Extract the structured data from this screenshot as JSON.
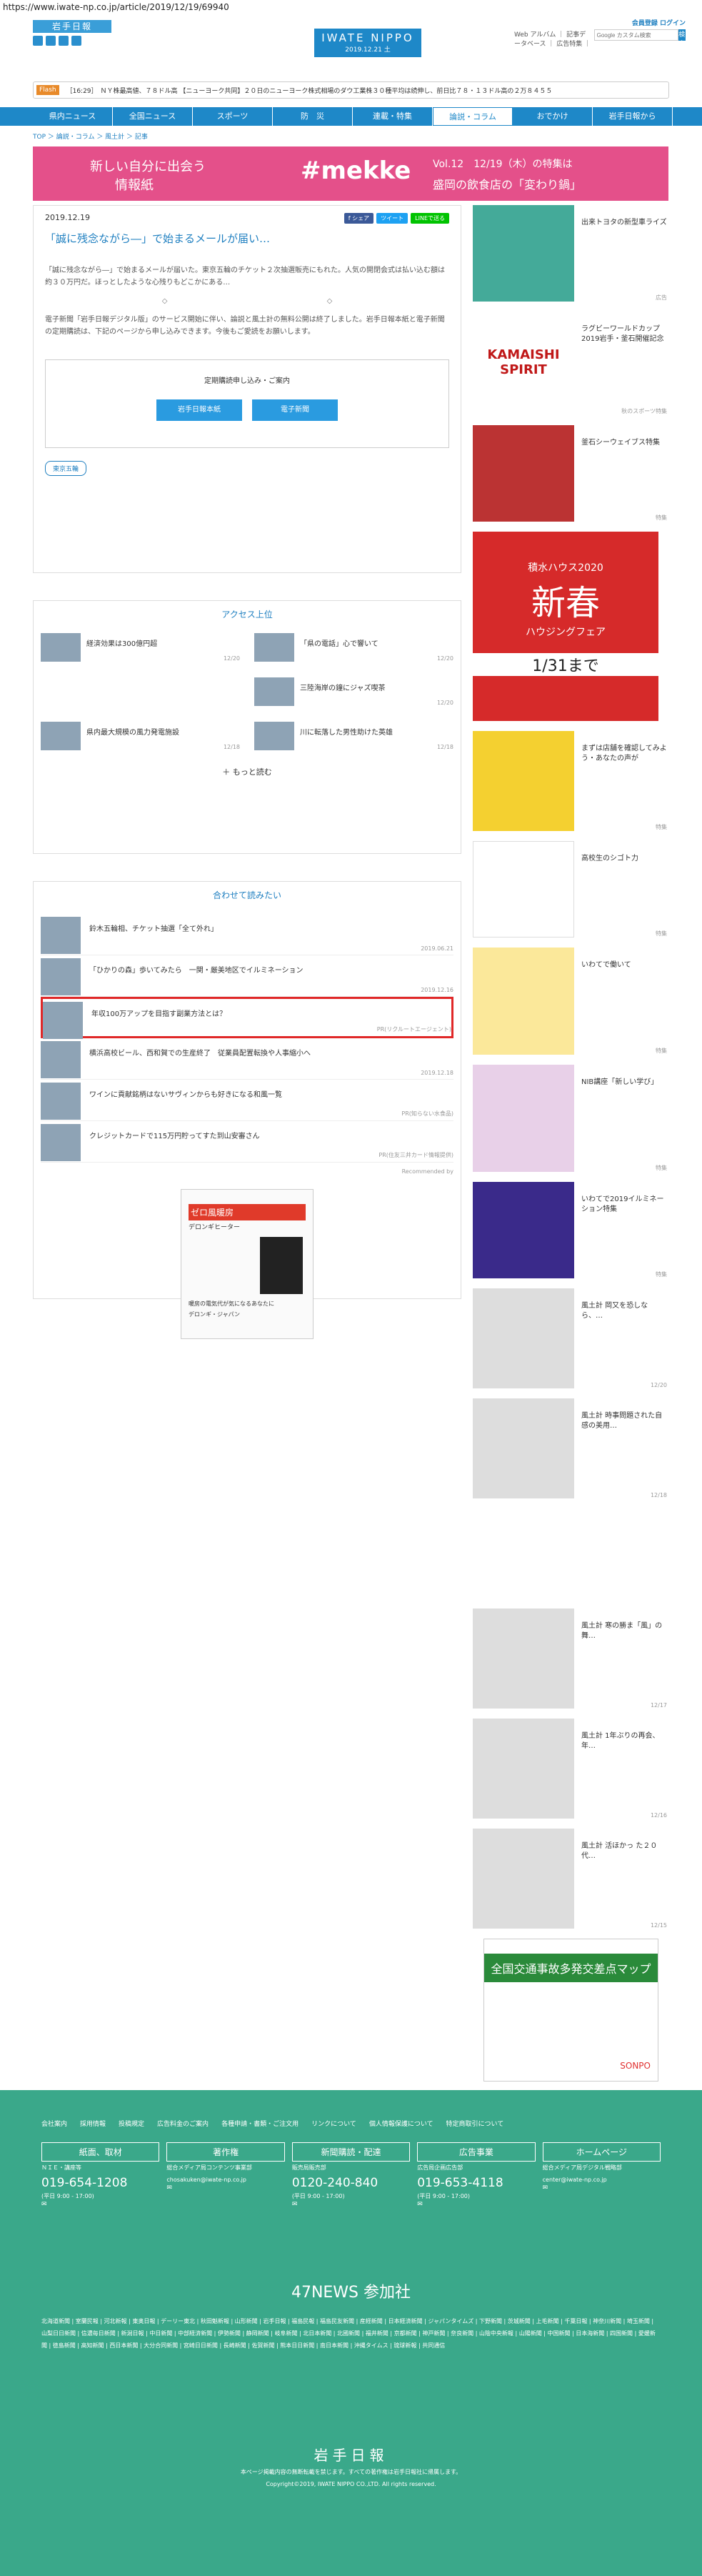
{
  "url": "https://www.iwate-np.co.jp/article/2019/12/19/69940",
  "header": {
    "logo": "岩手日報",
    "brand": "IWATE NIPPO",
    "date": "2019.12.21 土",
    "member_login": "会員登録  ログイン",
    "member_links": "Web アルバム ｜ 記事データベース ｜ 広告特集 ｜",
    "search_placeholder": "Google カスタム検索",
    "search_btn": "検索",
    "edition": "岩手日報から"
  },
  "flash": {
    "tag": "Flash",
    "time": "［16:29］",
    "text": "ＮＹ株最高値、７８ドル高  【ニューヨーク共同】２０日のニューヨーク株式相場のダウ工業株３０種平均は続伸し、前日比７８・１３ドル高の２万８４５５"
  },
  "nav": [
    "県内ニュース",
    "全国ニュース",
    "スポーツ",
    "防　災",
    "連載・特集",
    "論説・コラム",
    "おでかけ",
    "岩手日報から"
  ],
  "breadcrumb": "TOP ＞ 論説・コラム ＞ 風土計 ＞ 記事",
  "banner": {
    "left1": "新しい自分に出会う",
    "left2": "情報紙",
    "mid": "#mekke",
    "right1": "Vol.12　12/19（木）の特集は",
    "right2": "盛岡の飲食店の「変わり鍋」"
  },
  "article": {
    "date": "2019.12.19",
    "share": [
      "f シェア",
      "ツイート",
      "LINEで送る"
    ],
    "title": "「誠に残念ながら―」で始まるメールが届い…",
    "body": "「誠に残念ながら―」で始まるメールが届いた。東京五輪のチケット２次抽選販売にもれた。人気の開閉会式は払い込む額は約３０万円だ。ほっとしたような心残りもどこかにある…",
    "diamonds": "◇ ◇",
    "body2": "電子新聞「岩手日報デジタル版」のサービス開始に伴い、論説と風土計の無料公開は終了しました。岩手日報本紙と電子新聞の定期購読は、下記のページから申し込みできます。今後もご愛読をお願いします。",
    "subbox_title": "定期購読申し込み・ご案内",
    "btn1": "岩手日報本紙",
    "btn2": "電子新聞",
    "tag": "東京五輪"
  },
  "ranking": {
    "title": "アクセス上位",
    "items": [
      {
        "t": "経済効果は300億円超",
        "d": "12/20"
      },
      {
        "t": "「県の電話」心で響いて",
        "d": "12/20"
      },
      {
        "t": "",
        "d": ""
      },
      {
        "t": "三陸海岸の鐘にジャズ喫茶",
        "d": "12/20"
      },
      {
        "t": "県内最大規模の風力発電施設",
        "d": "12/18"
      },
      {
        "t": "川に転落した男性助けた英雄",
        "d": "12/18"
      }
    ],
    "more": "もっと読む"
  },
  "related": {
    "title": "合わせて読みたい",
    "items": [
      {
        "t": "鈴木五輪相、チケット抽選「全て外れ」",
        "d": "2019.06.21"
      },
      {
        "t": "「ひかりの森」歩いてみたら　一関・厳美地区でイルミネーション",
        "d": "2019.12.16"
      },
      {
        "t": "年収100万アップを目指す副業方法とは？",
        "d": "PR(リクルートエージェント)"
      },
      {
        "t": "横浜高校ビール、西和賀での生産終了　従業員配置転換や人事縮小へ",
        "d": "2019.12.18"
      },
      {
        "t": "ワインに貢献銘柄はないサヴィンからも好きになる和風一覧",
        "d": "PR(知らない水食品)"
      },
      {
        "t": "クレジットカードで115万円貯ってすた到山安審さん",
        "d": "PR(住友三井カード情報提供)"
      }
    ],
    "recommend": "Recommended by"
  },
  "ad": {
    "title": "ゼロ風暖房",
    "sub": "デロンギヒーター",
    "foot": "暖房の電気代が気になるあなたに",
    "brand": "デロンギ・ジャパン"
  },
  "side": [
    {
      "t": "出来トヨタの新型車ライズ",
      "d": "広告"
    },
    {
      "t": "ラグビーワールドカップ2019岩手・釜石開催記念",
      "d": "秋のスポーツ特集"
    },
    {
      "t": "釜石シーウェイブス特集",
      "d": "特集"
    },
    {
      "t": "",
      "d": ""
    },
    {
      "t": "まずは店舗を確認してみよう・あなたの声が",
      "d": "特集"
    },
    {
      "t": "高校生のシゴト力",
      "d": "特集"
    },
    {
      "t": "いわてで働いて",
      "d": "特集"
    },
    {
      "t": "NIB講座「新しい学び」",
      "d": "特集"
    },
    {
      "t": "いわてで2019イルミネーション特集",
      "d": "特集"
    },
    {
      "t": "風土計 岡又を恐しなら、…",
      "d": "12/20"
    },
    {
      "t": "風土計 時事問題された自感の美用…",
      "d": "12/18"
    },
    {
      "t": "風土計 寒の勝ま「風」の舞…",
      "d": "12/17"
    },
    {
      "t": "風土計 1年ぶりの再会、年…",
      "d": "12/16"
    },
    {
      "t": "風土計 活ほかっ た２０代…",
      "d": "12/15"
    }
  ],
  "side_ads": {
    "sekisui1": "積水ハウス2020",
    "sekisui2": "新春",
    "sekisui3": "ハウジングフェア",
    "sekisui4": "1/31まで",
    "kamaishi": "KAMAISHI SPIRIT",
    "kotsu": "全国交通事故多発交差点マップ",
    "sonpo": "SONPO"
  },
  "footer": {
    "links": [
      "会社案内",
      "採用情報",
      "投稿規定",
      "広告料金のご案内",
      "各種申請・書類・ご注文用",
      "リンクについて",
      "個人情報保護について",
      "特定商取引について"
    ],
    "cols": [
      {
        "h": "紙面、取材",
        "sub": "ＮＩＥ・講座等",
        "ph": "019-654-1208",
        "sm": "(平日 9:00 - 17:00)"
      },
      {
        "h": "著作権",
        "sub": "総合メディア局コンテンツ事業部",
        "ph": "",
        "sm": "chosakuken@iwate-np.co.jp"
      },
      {
        "h": "新聞購読・配達",
        "sub": "販売局販売部",
        "ph": "0120-240-840",
        "sm": "(平日 9:00 - 17:00)"
      },
      {
        "h": "広告事業",
        "sub": "広告局企画広告部",
        "ph": "019-653-4118",
        "sm": "(平日 9:00 - 17:00)"
      },
      {
        "h": "ホームページ",
        "sub": "総合メディア局デジタル戦略部",
        "ph": "",
        "sm": "center@iwate-np.co.jp"
      }
    ],
    "n47": "47NEWS 参加社",
    "members": "北海道新聞 | 室蘭民報 | 河北新報 | 東奥日報 | デーリー東北 | 秋田魁新報 | 山形新聞 | 岩手日報 | 福島民報 | 福島民友新聞 | 産経新聞 | 日本経済新聞 | ジャパンタイムズ | 下野新聞 | 茨城新聞 | 上毛新聞 | 千葉日報 | 神奈川新聞 | 埼玉新聞 | 山梨日日新聞 | 信濃毎日新聞 | 新潟日報 | 中日新聞 | 中部経済新聞 | 伊勢新聞 | 静岡新聞 | 岐阜新聞 | 北日本新聞 | 北國新聞 | 福井新聞 | 京都新聞 | 神戸新聞 | 奈良新聞 | 山陰中央新報 | 山陽新聞 | 中国新聞 | 日本海新聞 | 四国新聞 | 愛媛新聞 | 徳島新聞 | 高知新聞 | 西日本新聞 | 大分合同新聞 | 宮崎日日新聞 | 長崎新聞 | 佐賀新聞 | 熊本日日新聞 | 南日本新聞 | 沖縄タイムス | 琉球新報 | 共同通信",
    "logo": "岩手日報",
    "copy1": "本ページ掲載内容の無断転載を禁じます。すべての著作権は岩手日報社に帰属します。",
    "copy2": "Copyright©2019, IWATE NIPPO CO.,LTD. All rights reserved."
  }
}
